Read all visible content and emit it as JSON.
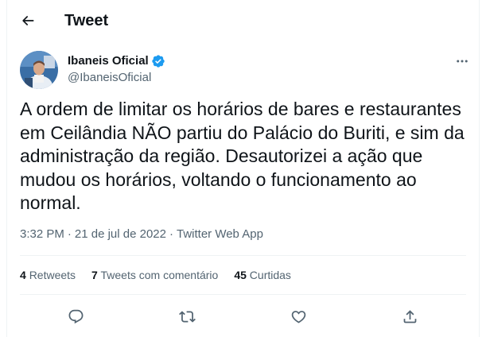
{
  "header": {
    "title": "Tweet",
    "back_icon": "arrow-left-icon"
  },
  "author": {
    "display_name": "Ibaneis Oficial",
    "handle": "@IbaneisOficial",
    "verified_icon": "verified-badge-icon",
    "verified_color": "#1d9bf0"
  },
  "tweet": {
    "text": "A ordem de limitar os horários de bares e restaurantes\nem Ceilândia NÃO partiu do Palácio do Buriti, e sim da\nadministração da região. Desautorizei a ação que\nmudou os horários, voltando o funcionamento ao\nnormal.",
    "time": "3:32 PM",
    "separator": "·",
    "date": "21 de jul de 2022",
    "source": "Twitter Web App"
  },
  "stats": {
    "retweets_count": "4",
    "retweets_label": "Retweets",
    "quotes_count": "7",
    "quotes_label": "Tweets com comentário",
    "likes_count": "45",
    "likes_label": "Curtidas"
  },
  "actions": {
    "reply_icon": "reply-icon",
    "retweet_icon": "retweet-icon",
    "like_icon": "heart-icon",
    "share_icon": "share-icon"
  },
  "colors": {
    "text": "#0f1419",
    "secondary": "#536471",
    "divider": "#eff3f4",
    "accent": "#1d9bf0"
  }
}
